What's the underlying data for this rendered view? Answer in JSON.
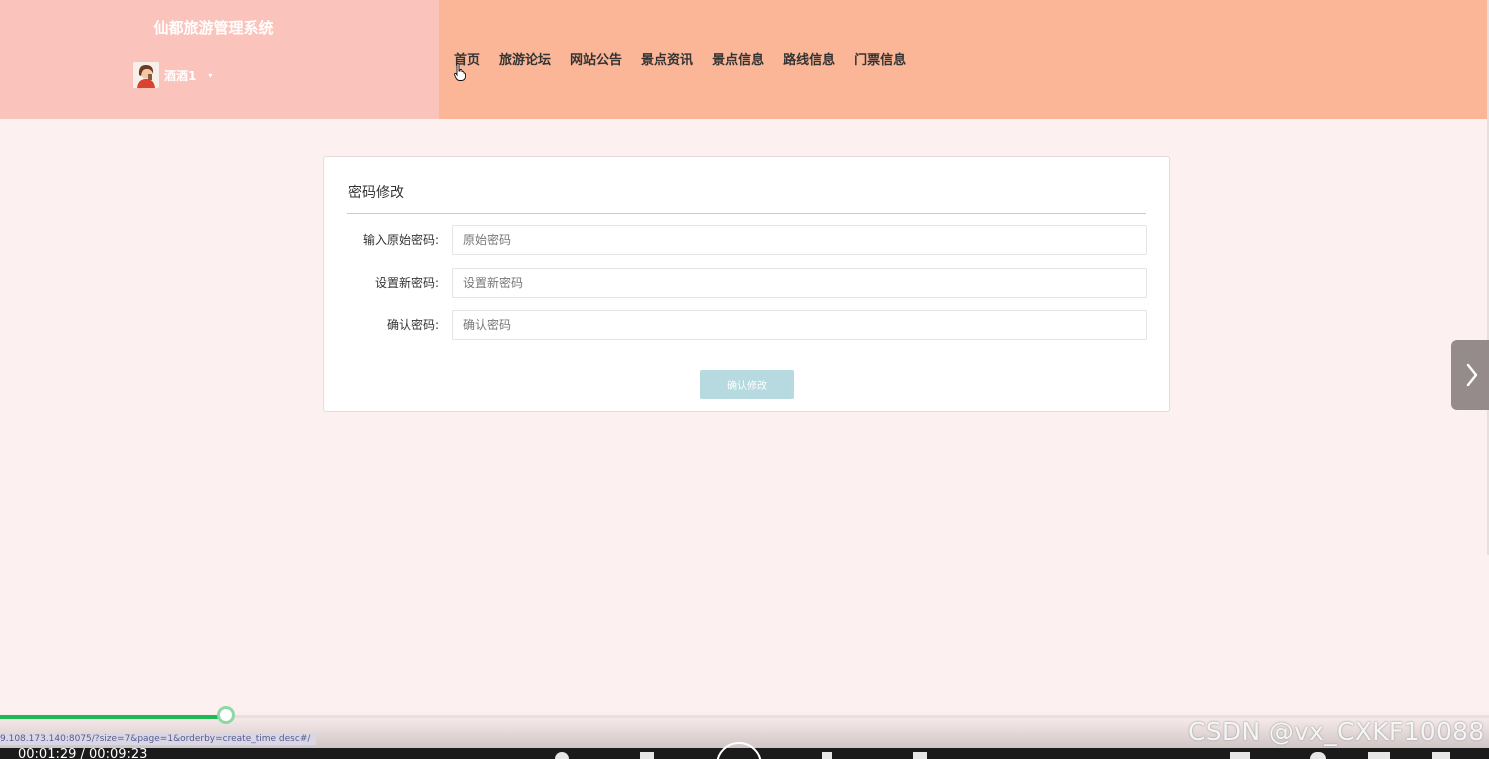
{
  "header": {
    "system_title": "仙都旅游管理系统",
    "username": "酒酒1",
    "caret": "▾"
  },
  "nav": {
    "items": [
      {
        "label": "首页",
        "name": "nav-home"
      },
      {
        "label": "旅游论坛",
        "name": "nav-forum"
      },
      {
        "label": "网站公告",
        "name": "nav-announcements"
      },
      {
        "label": "景点资讯",
        "name": "nav-scenic-news"
      },
      {
        "label": "景点信息",
        "name": "nav-scenic-info"
      },
      {
        "label": "路线信息",
        "name": "nav-route-info"
      },
      {
        "label": "门票信息",
        "name": "nav-ticket-info"
      }
    ]
  },
  "form": {
    "title": "密码修改",
    "fields": [
      {
        "label": "输入原始密码:",
        "placeholder": "原始密码",
        "value": ""
      },
      {
        "label": "设置新密码:",
        "placeholder": "设置新密码",
        "value": ""
      },
      {
        "label": "确认密码:",
        "placeholder": "确认密码",
        "value": ""
      }
    ],
    "submit_label": "确认修改"
  },
  "side_arrow": {
    "glyph": "›"
  },
  "player": {
    "progress": 0.152,
    "url": "9.108.173.140:8075/?size=7&page=1&orderby=create_time desc#/",
    "time": "00:01:29 / 00:09:23",
    "watermark": "CSDN @vx_CXKF10088"
  },
  "colors": {
    "brand_bg": "#fac3bb",
    "nav_bg": "#fbb698",
    "page_bg": "#fdf0f0",
    "submit_bg": "#b6dadf",
    "progress": "#1db954"
  },
  "icons": {
    "avatar": "user-avatar-icon",
    "caret": "caret-down-icon",
    "pointer": "hand-pointer-cursor-icon",
    "arrow": "chevron-right-icon"
  }
}
